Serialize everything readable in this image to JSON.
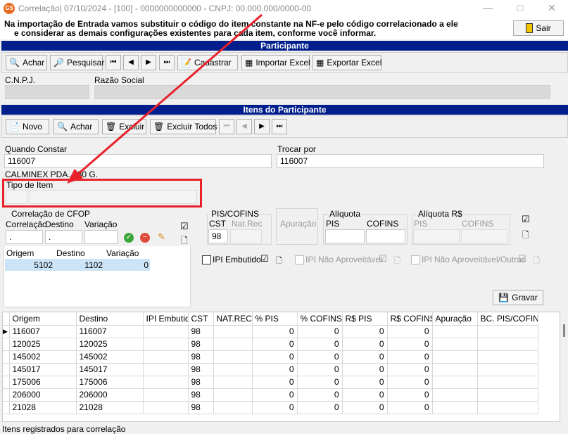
{
  "window": {
    "title": "Correlação|  07/10/2024 - [100] - 0000000000000 - CNPJ: 00.000.000/0000-00",
    "icon_text": "GS"
  },
  "info": {
    "line1": "Na importação de Entrada vamos substituir o código do item constante na NF-e pelo código correlacionado a ele",
    "line2": "e considerar as demais configurações existentes para cada item, conforme você informar.",
    "sair_label": "Sair"
  },
  "participante": {
    "header": "Participante",
    "toolbar": {
      "achar": "Achar",
      "pesquisar": "Pesquisar",
      "cadastrar": "Cadastrar",
      "importar": "Importar Excel",
      "exportar": "Exportar Excel"
    },
    "cnpj_label": "C.N.P.J.",
    "razao_label": "Razão Social"
  },
  "itens": {
    "header": "Itens do Participante",
    "toolbar": {
      "novo": "Novo",
      "achar": "Achar",
      "excluir": "Excluir",
      "excluir_todos": "Excluir Todos"
    },
    "quando_label": "Quando Constar",
    "quando_value": "116007",
    "trocar_label": "Trocar por",
    "trocar_value": "116007",
    "description": "CALMINEX PDA. 180 G.",
    "tipo_label": "Tipo de Item"
  },
  "cfop": {
    "title": "Correlação de CFOP",
    "correlacao_label": "Correlação",
    "destino_label": "Destino",
    "variacao_label": "Variação",
    "correlacao_value": ".",
    "destino_value": ".",
    "grid_headers": [
      "Origem",
      "Destino",
      "Variação"
    ],
    "grid_row": [
      "5102",
      "1102",
      "0"
    ]
  },
  "pis": {
    "title": "PIS/COFINS",
    "cst_label": "CST",
    "natrec_label": "Nat.Rec",
    "cst_value": "98",
    "apuracao_label": "Apuração",
    "aliquota_title": "Alíquota",
    "aliquota_pis": "PIS",
    "aliquota_cofins": "COFINS",
    "aliquota_rs_title": "Alíquota R$",
    "aliquota_rs_pis": "PIS",
    "aliquota_rs_cofins": "COFINS"
  },
  "ipi": {
    "embutido": "IPI Embutido",
    "nao_aproveitavel": "IPI Não Aproveitável",
    "nao_aproveitavel_outras": "IPI Não Aproveitável/Outras"
  },
  "gravar_label": "Gravar",
  "grid": {
    "headers": [
      "Origem",
      "Destino",
      "IPI Embutido",
      "CST",
      "NAT.REC.",
      "% PIS",
      "% COFINS",
      "R$ PIS",
      "R$ COFINS",
      "Apuração",
      "BC. PIS/COFINS"
    ],
    "rows": [
      [
        "116007",
        "116007",
        "",
        "98",
        "",
        "0",
        "0",
        "0",
        "0",
        "",
        ""
      ],
      [
        "120025",
        "120025",
        "",
        "98",
        "",
        "0",
        "0",
        "0",
        "0",
        "",
        ""
      ],
      [
        "145002",
        "145002",
        "",
        "98",
        "",
        "0",
        "0",
        "0",
        "0",
        "",
        ""
      ],
      [
        "145017",
        "145017",
        "",
        "98",
        "",
        "0",
        "0",
        "0",
        "0",
        "",
        ""
      ],
      [
        "175006",
        "175006",
        "",
        "98",
        "",
        "0",
        "0",
        "0",
        "0",
        "",
        ""
      ],
      [
        "206000",
        "206000",
        "",
        "98",
        "",
        "0",
        "0",
        "0",
        "0",
        "",
        ""
      ],
      [
        "21028",
        "21028",
        "",
        "98",
        "",
        "0",
        "0",
        "0",
        "0",
        "",
        ""
      ]
    ]
  },
  "status": "Itens registrados para correlação",
  "colors": {
    "header_bar": "#001f8c",
    "annotation": "#e8212a",
    "selection": "#cce4f7"
  }
}
